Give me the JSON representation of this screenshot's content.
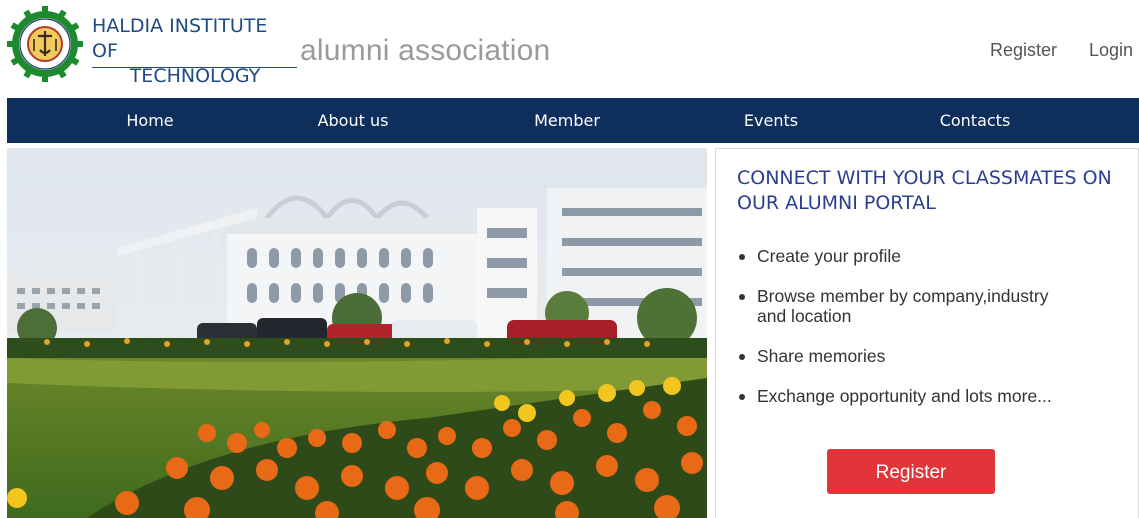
{
  "header": {
    "institute_line1": "HALDIA INSTITUTE OF",
    "institute_line2": "TECHNOLOGY",
    "association": "alumni association",
    "logo_icon": "institute-seal-gear-icon",
    "register_label": "Register",
    "login_label": "Login"
  },
  "nav": {
    "items": [
      {
        "label": "Home"
      },
      {
        "label": "About us"
      },
      {
        "label": "Member"
      },
      {
        "label": "Events"
      },
      {
        "label": "Contacts"
      }
    ]
  },
  "hero": {
    "image": "campus-building-with-flower-garden"
  },
  "panel": {
    "title": "CONNECT WITH YOUR CLASSMATES ON OUR ALUMNI PORTAL",
    "features": [
      {
        "text": "Create your profile"
      },
      {
        "text": "Browse member by company,industry and location"
      },
      {
        "text": "Share memories"
      },
      {
        "text": "Exchange opportunity and lots more..."
      }
    ],
    "register_button": "Register"
  },
  "colors": {
    "nav_bg": "#0e2e5c",
    "institute_text": "#1f4a86",
    "panel_title": "#2b3f8f",
    "button_bg": "#e2353a",
    "logo_green": "#1e8a2e"
  }
}
